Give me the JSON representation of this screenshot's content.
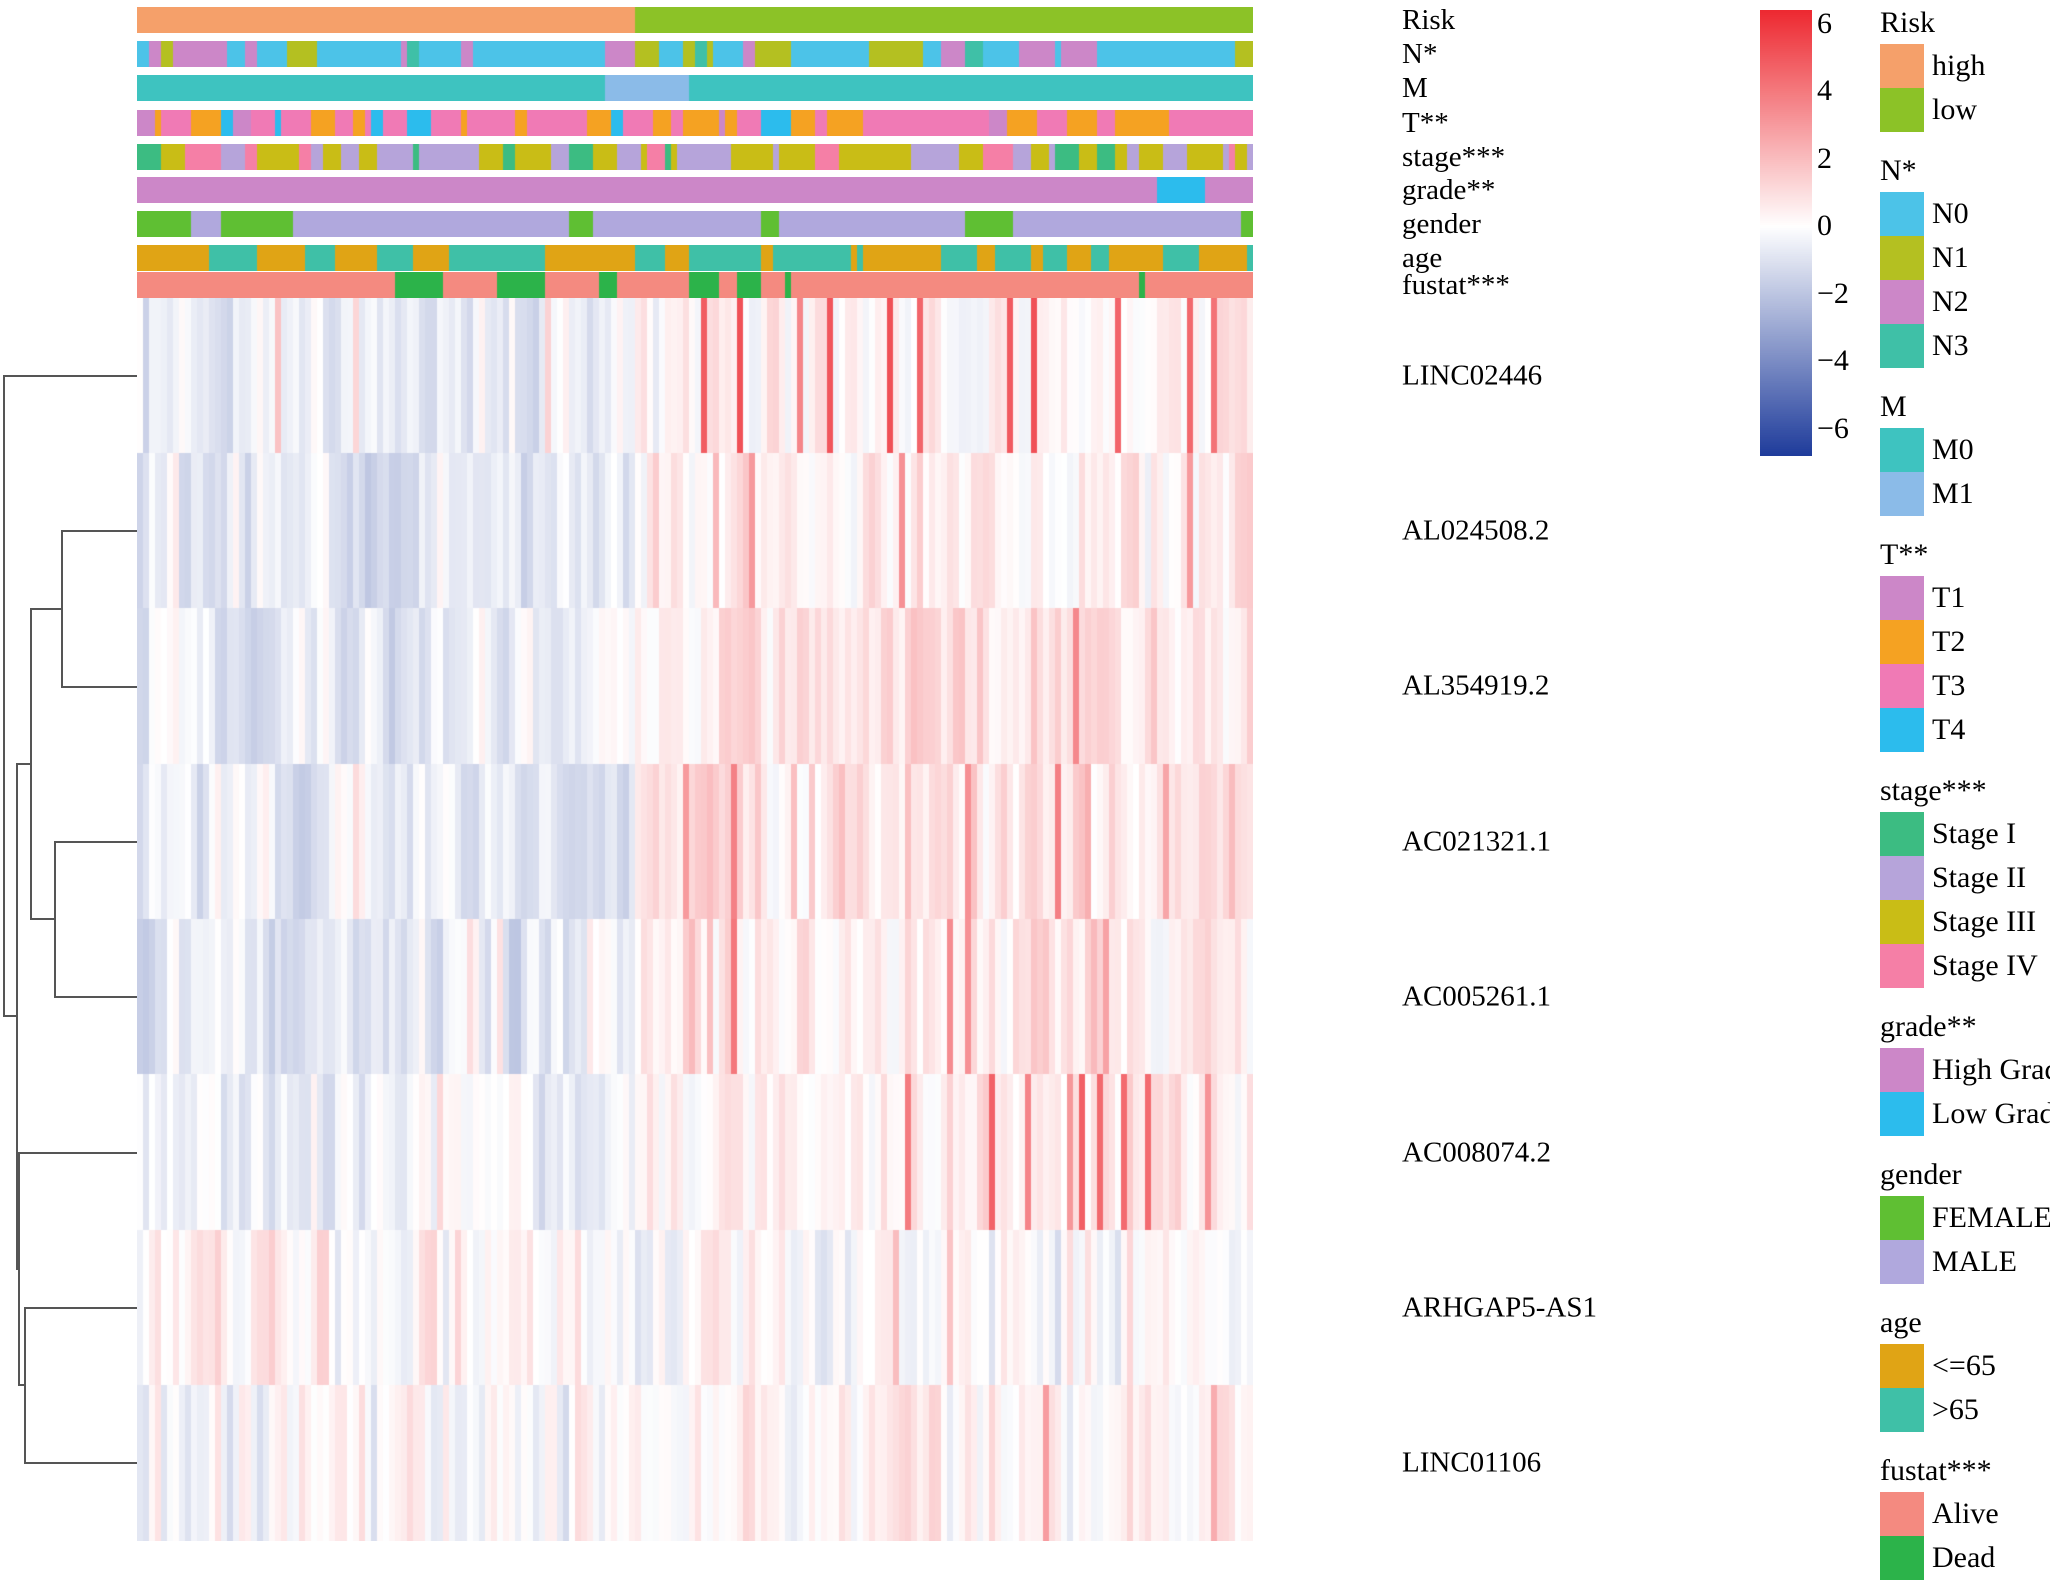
{
  "figure": {
    "type": "heatmap",
    "description": "Clustered expression heatmap with clinical annotation tracks"
  },
  "annotation_tracks": [
    {
      "name": "Risk",
      "label": "Risk"
    },
    {
      "name": "N",
      "label": "N*"
    },
    {
      "name": "M",
      "label": "M"
    },
    {
      "name": "T",
      "label": "T**"
    },
    {
      "name": "stage",
      "label": "stage***"
    },
    {
      "name": "grade",
      "label": "grade**"
    },
    {
      "name": "gender",
      "label": "gender"
    },
    {
      "name": "age",
      "label": "age"
    },
    {
      "name": "fustat",
      "label": "fustat***"
    }
  ],
  "row_labels": [
    "LINC02446",
    "AL024508.2",
    "AL354919.2",
    "AC021321.1",
    "AC005261.1",
    "AC008074.2",
    "ARHGAP5-AS1",
    "LINC01106"
  ],
  "colorbar": {
    "ticks": [
      "6",
      "4",
      "2",
      "0",
      "−2",
      "−4",
      "−6"
    ],
    "tick_values": [
      6,
      4,
      2,
      0,
      -2,
      -4,
      -6
    ],
    "vmin": -6.8,
    "vmax": 6.4,
    "low_color": "#1f3c9b",
    "mid_color": "#ffffff",
    "high_color": "#ec1c24"
  },
  "legends": [
    {
      "title": "Risk",
      "items": [
        {
          "label": "high",
          "color": "#f5a06a"
        },
        {
          "label": "low",
          "color": "#8cc227"
        }
      ]
    },
    {
      "title": "N*",
      "items": [
        {
          "label": "N0",
          "color": "#4cc3e8"
        },
        {
          "label": "N1",
          "color": "#b4c021"
        },
        {
          "label": "N2",
          "color": "#cc87c8"
        },
        {
          "label": "N3",
          "color": "#3fc0a7"
        }
      ]
    },
    {
      "title": "M",
      "items": [
        {
          "label": "M0",
          "color": "#3ec3c0"
        },
        {
          "label": "M1",
          "color": "#8bbbe8"
        }
      ]
    },
    {
      "title": "T**",
      "items": [
        {
          "label": "T1",
          "color": "#cc87c8"
        },
        {
          "label": "T2",
          "color": "#f5a222"
        },
        {
          "label": "T3",
          "color": "#f07ab5"
        },
        {
          "label": "T4",
          "color": "#2cbced"
        }
      ]
    },
    {
      "title": "stage***",
      "items": [
        {
          "label": "Stage I",
          "color": "#3cbc82"
        },
        {
          "label": "Stage II",
          "color": "#b6a4da"
        },
        {
          "label": "Stage III",
          "color": "#c9bd16"
        },
        {
          "label": "Stage IV",
          "color": "#f57fa6"
        }
      ]
    },
    {
      "title": "grade**",
      "items": [
        {
          "label": "High Grade",
          "color": "#cc87c8"
        },
        {
          "label": "Low Grade",
          "color": "#2cbced"
        }
      ]
    },
    {
      "title": "gender",
      "items": [
        {
          "label": "FEMALE",
          "color": "#5fbf33"
        },
        {
          "label": "MALE",
          "color": "#b0a8dd"
        }
      ]
    },
    {
      "title": "age",
      "items": [
        {
          "label": "<=65",
          "color": "#e0a415"
        },
        {
          "label": ">65",
          "color": "#3fc0a7"
        }
      ]
    },
    {
      "title": "fustat***",
      "items": [
        {
          "label": "Alive",
          "color": "#f48a80"
        },
        {
          "label": "Dead",
          "color": "#2cb34a"
        }
      ]
    }
  ],
  "chart_data": {
    "type": "heatmap",
    "title": "",
    "xlabel": "",
    "ylabel": "",
    "n_samples": 186,
    "n_genes": 8,
    "value_range": [
      -6.8,
      6.4
    ],
    "colormap": "blue-white-red (RdBu reversed)",
    "rows": [
      "LINC02446",
      "AL024508.2",
      "AL354919.2",
      "AC021321.1",
      "AC005261.1",
      "AC008074.2",
      "ARHGAP5-AS1",
      "LINC01106"
    ],
    "column_split": {
      "high_risk_fraction": 0.444,
      "low_risk_fraction": 0.556
    },
    "dendrogram": {
      "side": "row",
      "merges": "((LINC02446),(((AL024508.2,AL354919.2),(AC021321.1,AC005261.1))),((AC008074.2,(ARHGAP5-AS1,LINC01106))))"
    },
    "legend_position": "right",
    "grid": false
  }
}
